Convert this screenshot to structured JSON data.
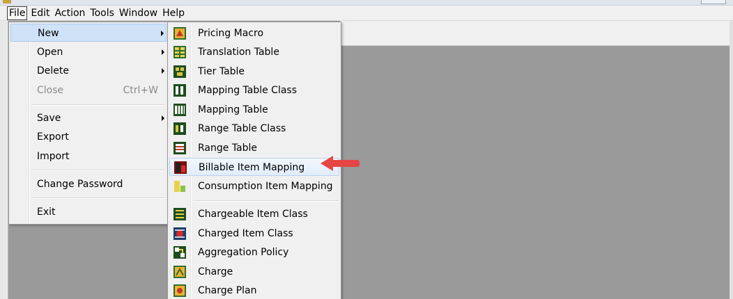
{
  "colors": {
    "accent_arrow": "#e64545",
    "highlight": "#cfe2f7"
  },
  "menubar": {
    "items": [
      {
        "label": "File",
        "active": true
      },
      {
        "label": "Edit"
      },
      {
        "label": "Action"
      },
      {
        "label": "Tools"
      },
      {
        "label": "Window"
      },
      {
        "label": "Help"
      }
    ]
  },
  "file_menu": {
    "new": "New",
    "open": "Open",
    "delete": "Delete",
    "close": "Close",
    "close_shortcut": "Ctrl+W",
    "save": "Save",
    "export": "Export",
    "import": "Import",
    "change_password": "Change Password",
    "exit": "Exit"
  },
  "new_menu": {
    "items": [
      {
        "label": "Pricing Macro",
        "icon": "pricing-macro-icon"
      },
      {
        "label": "Translation Table",
        "icon": "translation-table-icon"
      },
      {
        "label": "Tier Table",
        "icon": "tier-table-icon"
      },
      {
        "label": "Mapping Table Class",
        "icon": "mapping-table-class-icon"
      },
      {
        "label": "Mapping Table",
        "icon": "mapping-table-icon"
      },
      {
        "label": "Range Table Class",
        "icon": "range-table-class-icon"
      },
      {
        "label": "Range Table",
        "icon": "range-table-icon"
      },
      {
        "label": "Billable Item Mapping",
        "icon": "billable-item-mapping-icon",
        "highlighted": true
      },
      {
        "label": "Consumption Item Mapping",
        "icon": "consumption-item-mapping-icon"
      },
      {
        "label": "Chargeable Item Class",
        "icon": "chargeable-item-class-icon"
      },
      {
        "label": "Charged Item Class",
        "icon": "charged-item-class-icon"
      },
      {
        "label": "Aggregation Policy",
        "icon": "aggregation-policy-icon"
      },
      {
        "label": "Charge",
        "icon": "charge-icon"
      },
      {
        "label": "Charge Plan",
        "icon": "charge-plan-icon"
      }
    ]
  }
}
